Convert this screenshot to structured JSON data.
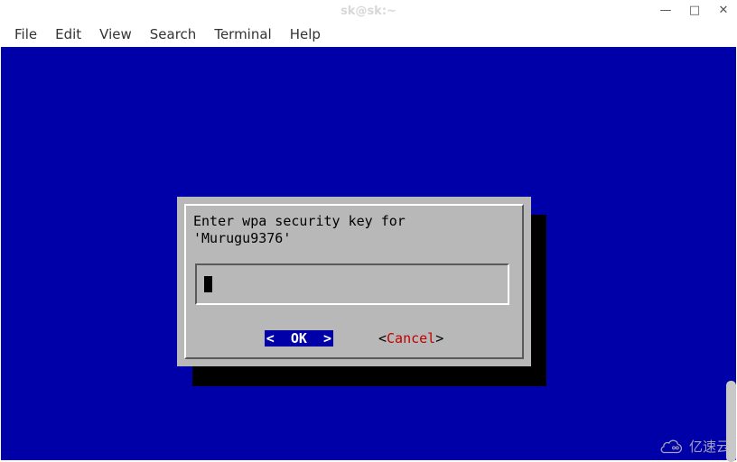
{
  "window": {
    "title": "sk@sk:~",
    "controls": {
      "minimize": "—",
      "maximize": "□",
      "close": "✕"
    }
  },
  "menu": {
    "items": [
      "File",
      "Edit",
      "View",
      "Search",
      "Terminal",
      "Help"
    ]
  },
  "dialog": {
    "prompt_line1": "Enter wpa security key for",
    "prompt_line2": "'Murugu9376'",
    "input_value": "",
    "ok_label": "<  OK  >",
    "cancel_bracket_left": "<",
    "cancel_label": "Cancel",
    "cancel_bracket_right": ">"
  },
  "watermark": {
    "text": "亿速云"
  }
}
